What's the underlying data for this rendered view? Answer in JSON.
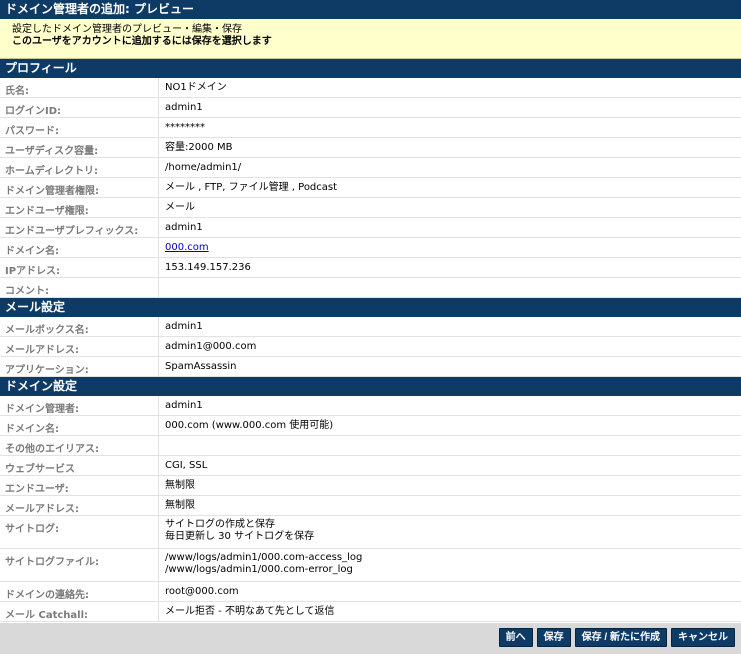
{
  "title": "ドメイン管理者の追加: プレビュー",
  "info": {
    "line1": "設定したドメイン管理者のプレビュー・編集・保存",
    "line2": "このユーザをアカウントに追加するには保存を選択します"
  },
  "sections": {
    "profile": {
      "header": "プロフィール",
      "rows": [
        {
          "label": "氏名:",
          "value": "NO1ドメイン"
        },
        {
          "label": "ログインID:",
          "value": "admin1"
        },
        {
          "label": "パスワード:",
          "value": "********"
        },
        {
          "label": "ユーザディスク容量:",
          "value": "容量:2000 MB"
        },
        {
          "label": "ホームディレクトリ:",
          "value": "/home/admin1/"
        },
        {
          "label": "ドメイン管理者権限:",
          "value": "メール , FTP, ファイル管理 , Podcast"
        },
        {
          "label": "エンドユーザ権限:",
          "value": "メール"
        },
        {
          "label": "エンドユーザプレフィックス:",
          "value": "admin1"
        },
        {
          "label": "ドメイン名:",
          "value": "000.com"
        },
        {
          "label": "IPアドレス:",
          "value": "153.149.157.236"
        },
        {
          "label": "コメント:",
          "value": ""
        }
      ]
    },
    "mail": {
      "header": "メール設定",
      "rows": [
        {
          "label": "メールボックス名:",
          "value": "admin1"
        },
        {
          "label": "メールアドレス:",
          "value": "admin1@000.com"
        },
        {
          "label": "アプリケーション:",
          "value": "SpamAssassin"
        }
      ]
    },
    "domain": {
      "header": "ドメイン設定",
      "rows": [
        {
          "label": "ドメイン管理者:",
          "value": "admin1"
        },
        {
          "label": "ドメイン名:",
          "value": "000.com (www.000.com 使用可能)"
        },
        {
          "label": "その他のエイリアス:",
          "value": ""
        },
        {
          "label": "ウェブサービス",
          "value": "CGI, SSL"
        },
        {
          "label": "エンドユーザ:",
          "value": "無制限"
        },
        {
          "label": "メールアドレス:",
          "value": "無制限"
        },
        {
          "label": "サイトログ:",
          "value": "サイトログの作成と保存",
          "value2": "毎日更新し 30 サイトログを保存"
        },
        {
          "label": "サイトログファイル:",
          "value": "/www/logs/admin1/000.com-access_log",
          "value2": "/www/logs/admin1/000.com-error_log"
        },
        {
          "label": "ドメインの連絡先:",
          "value": "root@000.com"
        },
        {
          "label": "メール Catchall:",
          "value": "メール拒否 - 不明なあて先として返信"
        }
      ]
    }
  },
  "buttons": {
    "back": "前へ",
    "save": "保存",
    "save_new": "保存 / 新たに作成",
    "cancel": "キャンセル"
  },
  "colors": {
    "header_bg": "#0e3a66",
    "info_bg": "#ffffcc",
    "link": "#0000cc"
  }
}
